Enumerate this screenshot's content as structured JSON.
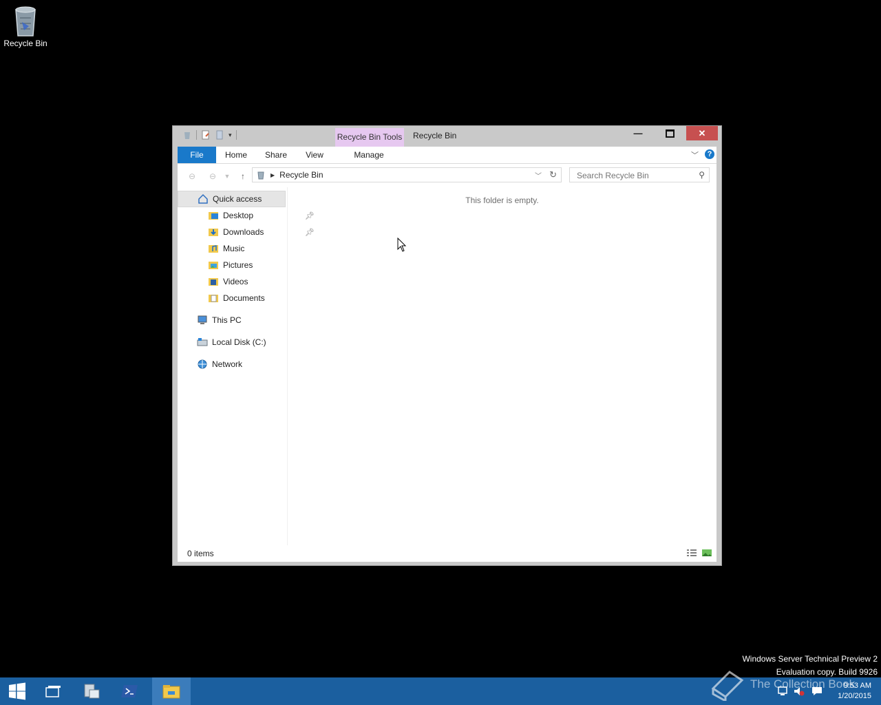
{
  "desktop": {
    "recycle_bin_label": "Recycle Bin"
  },
  "window": {
    "title": "Recycle Bin",
    "contextual_tab_group": "Recycle Bin Tools",
    "ribbon_tabs": {
      "file": "File",
      "home": "Home",
      "share": "Share",
      "view": "View",
      "manage": "Manage"
    },
    "address": {
      "path": "Recycle Bin"
    },
    "search": {
      "placeholder": "Search Recycle Bin"
    },
    "nav": {
      "quick_access": "Quick access",
      "desktop": "Desktop",
      "downloads": "Downloads",
      "music": "Music",
      "pictures": "Pictures",
      "videos": "Videos",
      "documents": "Documents",
      "this_pc": "This PC",
      "local_disk": "Local Disk (C:)",
      "network": "Network"
    },
    "empty_message": "This folder is empty.",
    "status": {
      "items": "0 items"
    }
  },
  "watermark": {
    "line1": "Windows Server Technical Preview 2",
    "line2": "Evaluation copy. Build 9926",
    "brand": "The Collection Book"
  },
  "taskbar": {
    "time": "9:53 AM",
    "date": "1/20/2015"
  },
  "colors": {
    "taskbar": "#1b5f9f",
    "file_tab": "#1979ca",
    "context_tab": "#e6c8f0",
    "close_button": "#c75050"
  }
}
